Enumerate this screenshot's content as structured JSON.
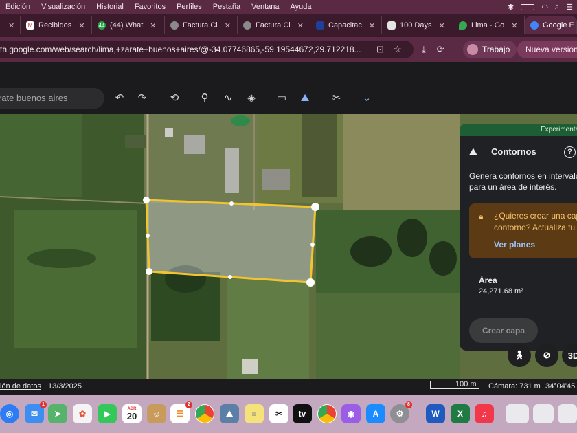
{
  "menubar": {
    "items": [
      "Edición",
      "Visualización",
      "Historial",
      "Favoritos",
      "Perfiles",
      "Pestaña",
      "Ventana",
      "Ayuda"
    ],
    "status_icons": [
      "bluetooth-icon",
      "battery-icon",
      "wifi-icon",
      "search-icon",
      "control-center-icon"
    ]
  },
  "tabs": [
    {
      "label": "",
      "fav": "",
      "color": "#555555"
    },
    {
      "label": "Recibidos",
      "fav": "M",
      "color": "#d93025"
    },
    {
      "label": "(44) What",
      "fav": "44",
      "color": "#25a244"
    },
    {
      "label": "Factura Cl",
      "fav": "",
      "color": "#8a8a8a"
    },
    {
      "label": "Factura Cl",
      "fav": "",
      "color": "#8a8a8a"
    },
    {
      "label": "Capacitac",
      "fav": "",
      "color": "#1e3f9a"
    },
    {
      "label": "100 Days",
      "fav": "",
      "color": "#e5e5e5"
    },
    {
      "label": "Lima - Go",
      "fav": "",
      "color": "#34a853"
    },
    {
      "label": "Google E",
      "fav": "",
      "color": "#4285f4"
    }
  ],
  "url": "th.google.com/web/search/lima,+zarate+buenos+aires/@-34.07746865,-59.19544672,29.712218...",
  "profile": {
    "label": "Trabajo"
  },
  "new_version": "Nueva versión d",
  "search": {
    "placeholder": "rate buenos aires"
  },
  "panel": {
    "experimental": "Experimenta",
    "title": "Contornos",
    "help": "?",
    "description_line1": "Genera contornos en intervalo",
    "description_line2": "para un área de interés.",
    "warning_line1": "¿Quieres crear una cap",
    "warning_line2": "contorno? Actualiza tu p",
    "plans_link": "Ver planes",
    "area_label": "Área",
    "area_value": "24,271.68 m²",
    "create_button": "Crear capa"
  },
  "map_buttons": {
    "mode_3d": "3D"
  },
  "status": {
    "data_info": "ión de datos",
    "date": "13/3/2025",
    "scale": "100 m",
    "camera": "Cámara: 731 m",
    "coords": "34°04'45."
  },
  "dock": {
    "calendar_month": "ABR",
    "calendar_day": "20",
    "badges": {
      "mail": "1",
      "reminders": "2",
      "settings": "8"
    }
  }
}
